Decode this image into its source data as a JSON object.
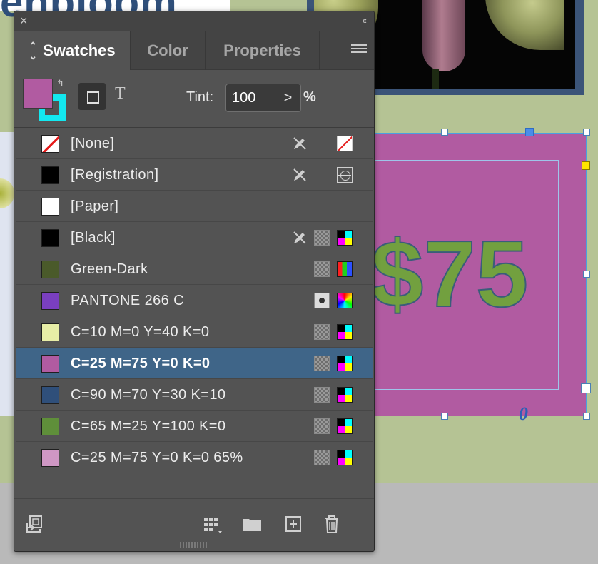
{
  "document": {
    "logo_text": "enbloom",
    "price_text": "$75",
    "glyph_text": "0"
  },
  "panel": {
    "close_label": "×",
    "collapse_label": "‹‹",
    "tabs": [
      {
        "label": "Swatches",
        "active": true
      },
      {
        "label": "Color",
        "active": false
      },
      {
        "label": "Properties",
        "active": false
      }
    ],
    "menu_icon": "hamburger-icon"
  },
  "controls": {
    "fill_color": "#b15ba1",
    "stroke_color": "#13e8f0",
    "tint_label": "Tint:",
    "tint_value": "100",
    "tint_stepper": ">",
    "tint_unit": "%",
    "text_format_label": "T"
  },
  "swatches": [
    {
      "name": "[None]",
      "color": "none",
      "locked": true,
      "type_icon": "none"
    },
    {
      "name": "[Registration]",
      "color": "#000000",
      "locked": true,
      "type_icon": "registration"
    },
    {
      "name": "[Paper]",
      "color": "#ffffff",
      "locked": false,
      "type_icon": ""
    },
    {
      "name": "[Black]",
      "color": "#000000",
      "locked": true,
      "mode": "process",
      "type_icon": "cmyk"
    },
    {
      "name": "Green-Dark",
      "color": "#4a5a2a",
      "locked": false,
      "mode": "process",
      "type_icon": "rgb"
    },
    {
      "name": "PANTONE 266 C",
      "color": "#7a3fc0",
      "locked": false,
      "mode": "spot",
      "type_icon": "lab"
    },
    {
      "name": "C=10 M=0 Y=40 K=0",
      "color": "#e7eda6",
      "locked": false,
      "mode": "process",
      "type_icon": "cmyk"
    },
    {
      "name": "C=25 M=75 Y=0 K=0",
      "color": "#b15ba1",
      "locked": false,
      "mode": "process",
      "type_icon": "cmyk",
      "selected": true
    },
    {
      "name": "C=90 M=70 Y=30 K=10",
      "color": "#2f4f7a",
      "locked": false,
      "mode": "process",
      "type_icon": "cmyk"
    },
    {
      "name": "C=65 M=25 Y=100 K=0",
      "color": "#5f8f3a",
      "locked": false,
      "mode": "process",
      "type_icon": "cmyk"
    },
    {
      "name": "C=25 M=75 Y=0 K=0 65%",
      "color": "#cf97c4",
      "locked": false,
      "mode": "process",
      "type_icon": "cmyk"
    }
  ],
  "bottom_icons": [
    "place-swatch-icon",
    "show-kinds-icon",
    "new-group-icon",
    "new-swatch-icon",
    "delete-icon"
  ]
}
